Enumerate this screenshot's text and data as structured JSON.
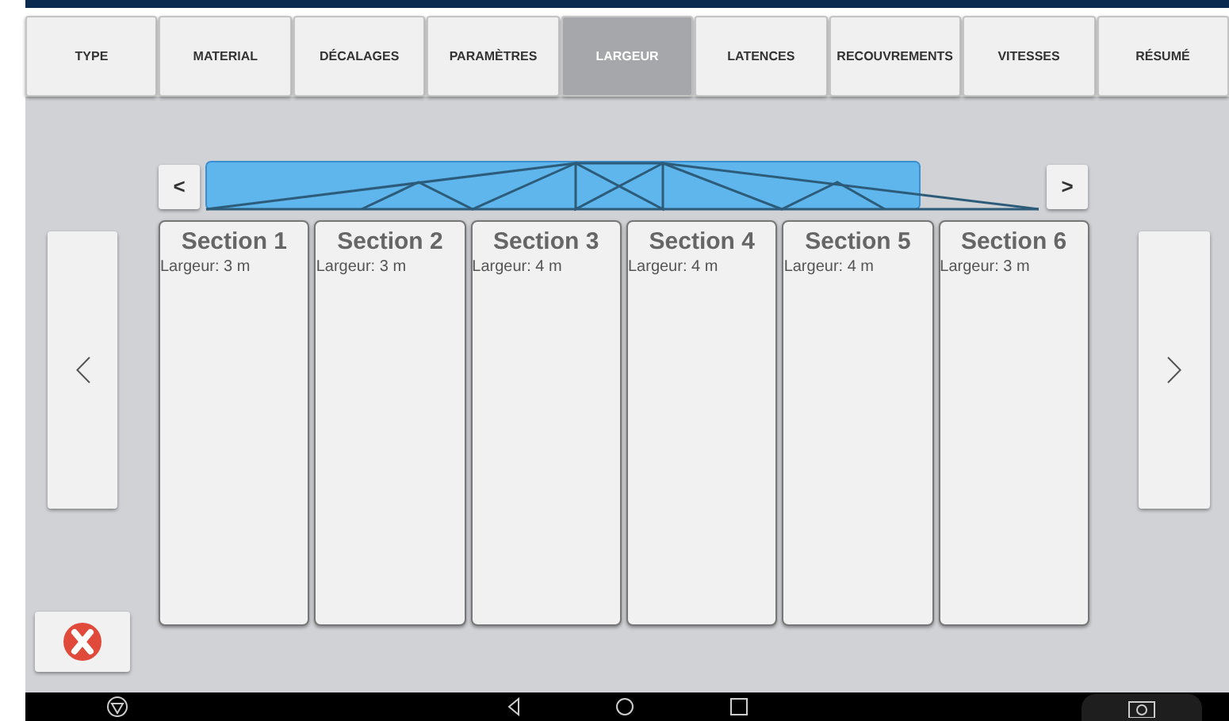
{
  "tabs": [
    {
      "label": "TYPE",
      "selected": false
    },
    {
      "label": "MATERIAL",
      "selected": false
    },
    {
      "label": "DÉCALAGES",
      "selected": false
    },
    {
      "label": "PARAMÈTRES",
      "selected": false
    },
    {
      "label": "LARGEUR",
      "selected": true
    },
    {
      "label": "LATENCES",
      "selected": false
    },
    {
      "label": "RECOUVREMENTS",
      "selected": false
    },
    {
      "label": "VITESSES",
      "selected": false
    },
    {
      "label": "RÉSUMÉ",
      "selected": false
    }
  ],
  "truss": {
    "prev": "<",
    "next": ">"
  },
  "sections": [
    {
      "title": "Section 1",
      "width": "Largeur: 3 m"
    },
    {
      "title": "Section 2",
      "width": "Largeur: 3 m"
    },
    {
      "title": "Section 3",
      "width": "Largeur: 4 m"
    },
    {
      "title": "Section 4",
      "width": "Largeur: 4 m"
    },
    {
      "title": "Section 5",
      "width": "Largeur: 4 m"
    },
    {
      "title": "Section 6",
      "width": "Largeur: 3 m"
    }
  ]
}
